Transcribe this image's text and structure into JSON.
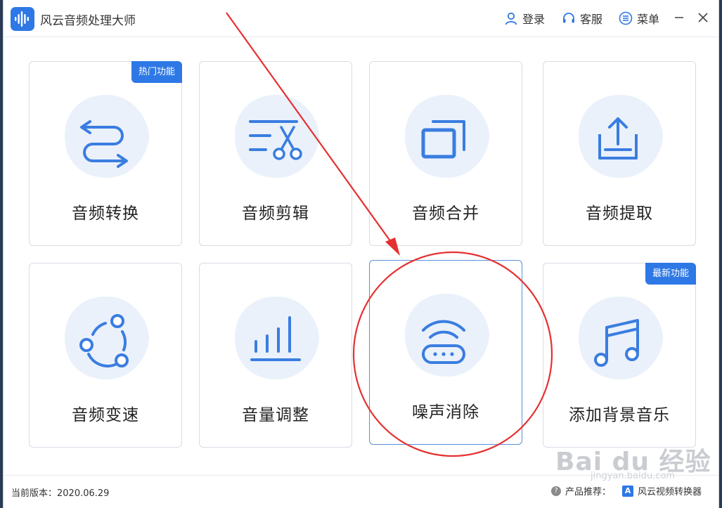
{
  "window": {
    "title": "风云音频处理大师",
    "buttons": {
      "login": "登录",
      "service": "客服",
      "menu": "菜单"
    }
  },
  "cards": [
    {
      "label": "音频转换",
      "badge": "热门功能",
      "icon": "convert-icon"
    },
    {
      "label": "音频剪辑",
      "badge": "",
      "icon": "scissors-icon"
    },
    {
      "label": "音频合并",
      "badge": "",
      "icon": "merge-icon"
    },
    {
      "label": "音频提取",
      "badge": "",
      "icon": "extract-icon"
    },
    {
      "label": "音频变速",
      "badge": "",
      "icon": "speed-icon"
    },
    {
      "label": "音量调整",
      "badge": "",
      "icon": "volume-icon"
    },
    {
      "label": "噪声消除",
      "badge": "",
      "icon": "noise-icon",
      "selected": true
    },
    {
      "label": "添加背景音乐",
      "badge": "最新功能",
      "icon": "music-note-icon"
    }
  ],
  "footer": {
    "version": "当前版本：2020.06.29",
    "recommend_label": "产品推荐：",
    "recommend_product": "风云视频转换器"
  },
  "watermark": {
    "text": "Bai du 经验",
    "url": "jingyan.baidu.com"
  },
  "colors": {
    "accent": "#2e78e6",
    "blob": "#eaf1fb",
    "annotation": "#e63030"
  }
}
